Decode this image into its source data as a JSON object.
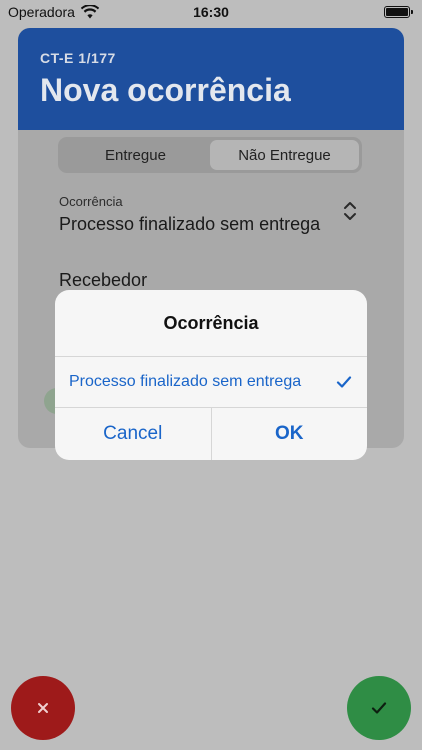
{
  "status_bar": {
    "carrier": "Operadora",
    "time": "16:30"
  },
  "card": {
    "subtitle": "CT-E 1/177",
    "title": "Nova ocorrência",
    "segments": [
      "Entregue",
      "Não Entregue"
    ],
    "selected_segment": "Não Entregue",
    "ocorrencia_label": "Ocorrência",
    "ocorrencia_value": "Processo finalizado sem entrega",
    "recebedor_label": "Recebedor"
  },
  "dialog": {
    "title": "Ocorrência",
    "option": "Processo finalizado sem entrega",
    "cancel_label": "Cancel",
    "ok_label": "OK"
  },
  "colors": {
    "header_blue": "#1e4f9e",
    "action_blue": "#1a65c9",
    "cancel_red": "#9e1a1a",
    "confirm_green": "#2f8d45"
  },
  "icons": {
    "wifi": "wifi-icon",
    "battery": "battery-icon",
    "chevron": "chevron-up-down-icon",
    "check": "checkmark-icon",
    "close": "close-icon",
    "confirm": "checkmark-icon"
  }
}
